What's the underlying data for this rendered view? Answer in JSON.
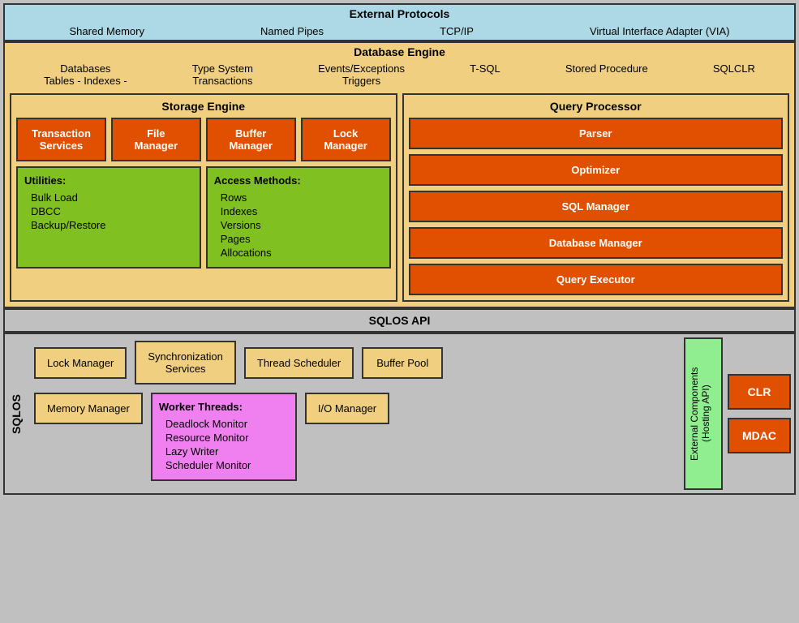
{
  "external_protocols": {
    "title": "External Protocols",
    "items": [
      "Shared Memory",
      "Named Pipes",
      "TCP/IP",
      "Virtual Interface Adapter (VIA)"
    ]
  },
  "db_engine": {
    "title": "Database Engine",
    "header": [
      "Databases\nTables - Indexes -",
      "Type System\nTransactions",
      "Events/Exceptions\nTriggers",
      "T-SQL",
      "Stored Procedure",
      "SQLCLR"
    ]
  },
  "storage_engine": {
    "title": "Storage Engine",
    "boxes": [
      {
        "label": "Transaction\nServices"
      },
      {
        "label": "File\nManager"
      },
      {
        "label": "Buffer\nManager"
      },
      {
        "label": "Lock\nManager"
      }
    ],
    "utilities": {
      "title": "Utilities:",
      "items": [
        "Bulk Load",
        "DBCC",
        "Backup/Restore"
      ]
    },
    "access_methods": {
      "title": "Access Methods:",
      "items": [
        "Rows",
        "Indexes",
        "Versions",
        "Pages",
        "Allocations"
      ]
    }
  },
  "query_processor": {
    "title": "Query Processor",
    "boxes": [
      "Parser",
      "Optimizer",
      "SQL Manager",
      "Database Manager",
      "Query Executor"
    ]
  },
  "sqlos_api": {
    "label": "SQLOS API"
  },
  "sqlos": {
    "label": "SQLOS",
    "row1": [
      {
        "label": "Lock Manager"
      },
      {
        "label": "Synchronization\nServices"
      },
      {
        "label": "Thread Scheduler"
      },
      {
        "label": "Buffer Pool"
      }
    ],
    "row2_left": [
      {
        "label": "Memory Manager"
      }
    ],
    "worker_threads": {
      "title": "Worker Threads:",
      "items": [
        "Deadlock Monitor",
        "Resource Monitor",
        "Lazy Writer",
        "Scheduler Monitor"
      ]
    },
    "io_manager": {
      "label": "I/O Manager"
    },
    "external_components": "External Components\n(Hosting API)",
    "clr": "CLR",
    "mdac": "MDAC"
  }
}
